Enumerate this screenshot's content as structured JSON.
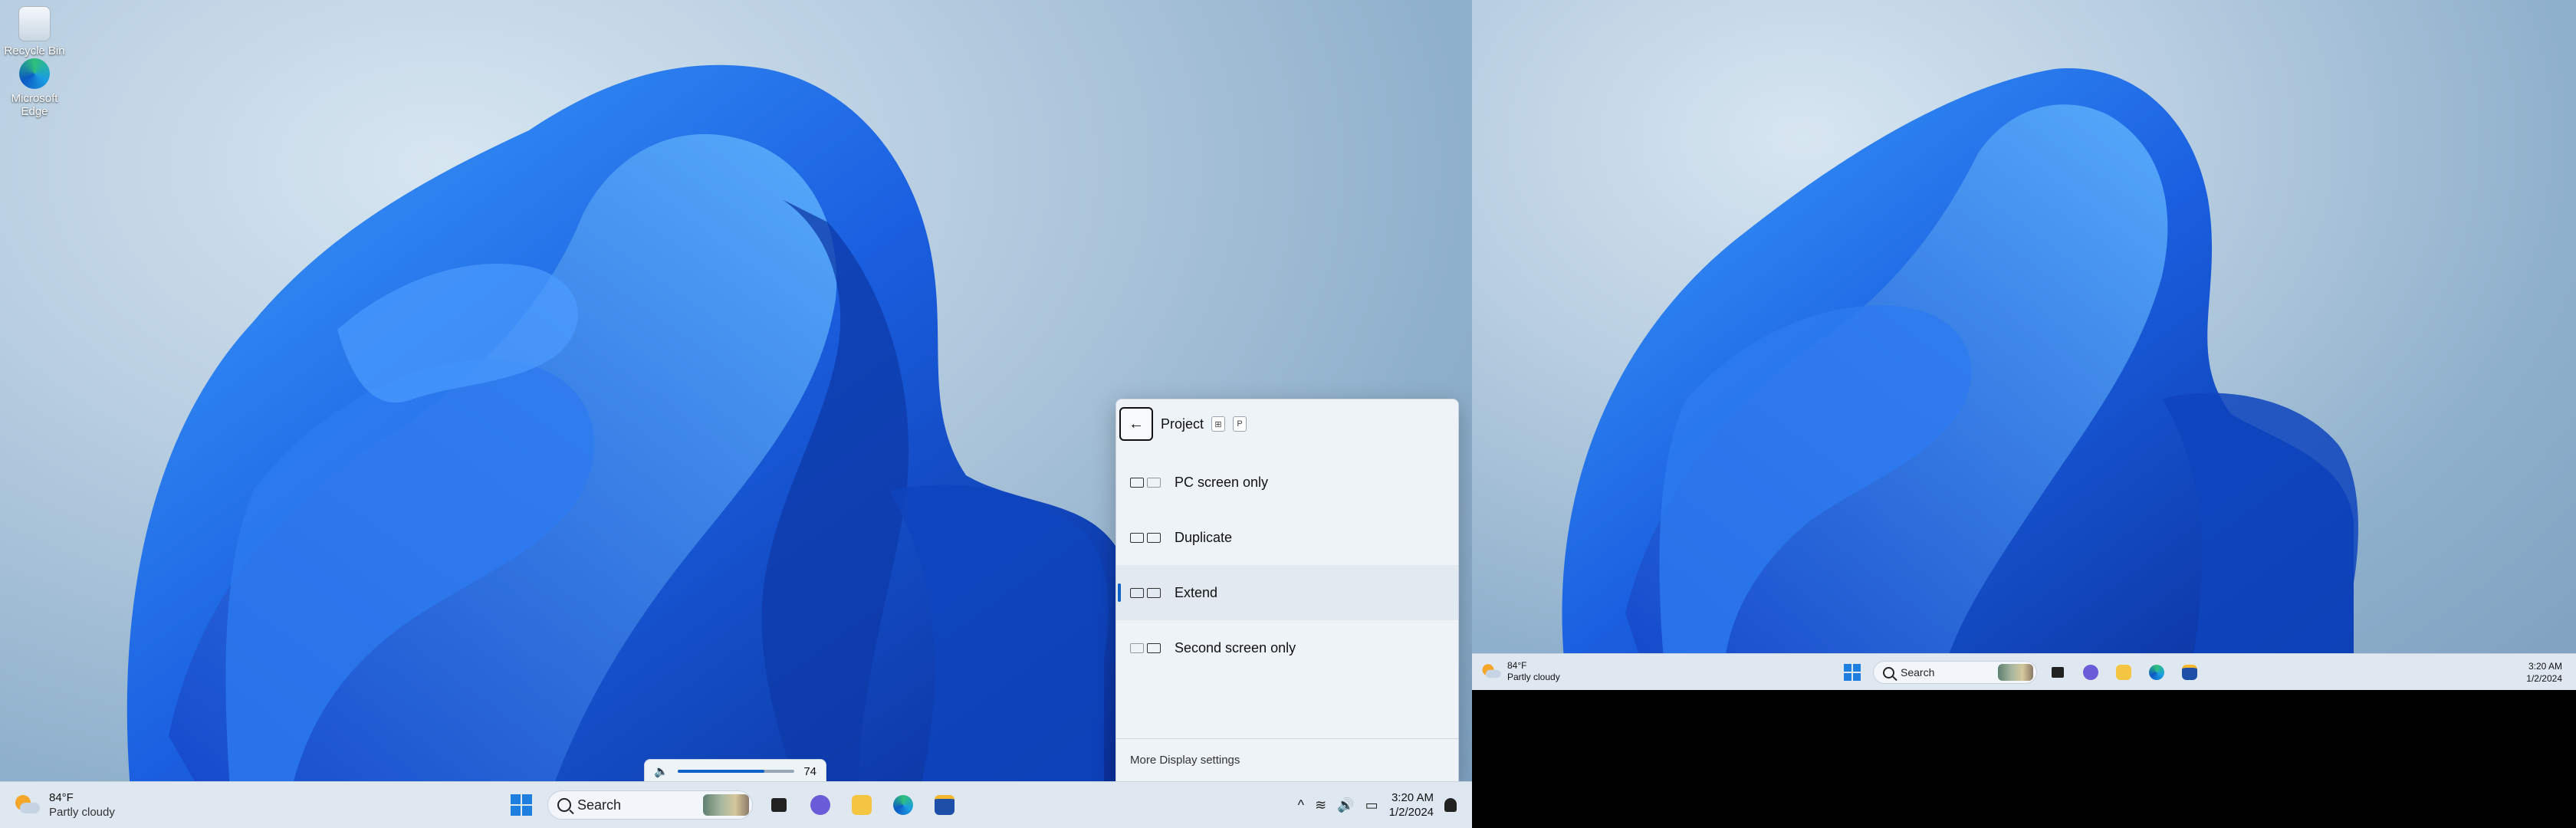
{
  "desktop": {
    "icons": [
      {
        "label": "Recycle Bin"
      },
      {
        "label": "Microsoft Edge"
      }
    ]
  },
  "taskbar": {
    "weather": {
      "temp": "84°F",
      "condition": "Partly cloudy"
    },
    "search": {
      "placeholder": "Search"
    },
    "pinned_apps": [
      "task-view",
      "chat",
      "file-explorer",
      "microsoft-edge",
      "microsoft-store"
    ],
    "tray": {
      "overflow_glyph": "^",
      "wifi_glyph": "≋",
      "volume_glyph": "🔊",
      "battery_glyph": "▭"
    },
    "clock": {
      "time": "3:20 AM",
      "date": "1/2/2024"
    }
  },
  "volume": {
    "level": 74
  },
  "project": {
    "title": "Project",
    "shortcut_keys": [
      "⊞",
      "P"
    ],
    "back_glyph": "←",
    "options": [
      {
        "label": "PC screen only",
        "selected": false
      },
      {
        "label": "Duplicate",
        "selected": false
      },
      {
        "label": "Extend",
        "selected": true
      },
      {
        "label": "Second screen only",
        "selected": false
      }
    ],
    "footer_link": "More Display settings"
  },
  "taskbar2": {
    "weather": {
      "temp": "84°F",
      "condition": "Partly cloudy"
    },
    "search": {
      "placeholder": "Search"
    },
    "clock": {
      "time": "3:20 AM",
      "date": "1/2/2024"
    }
  },
  "colors": {
    "accent": "#0f62c8",
    "taskbar": "#dfe8f1",
    "bloom": "#1a5fe0"
  }
}
